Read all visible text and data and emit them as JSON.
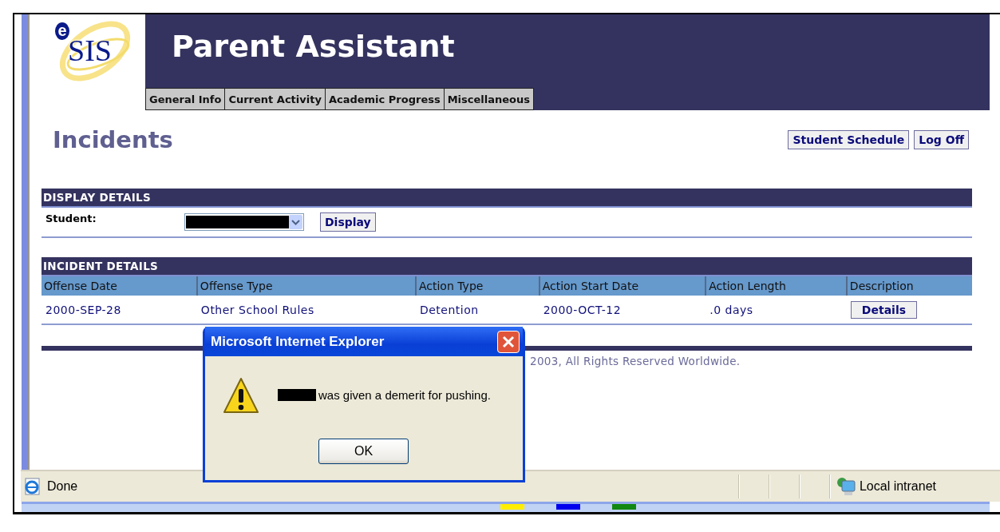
{
  "app": {
    "logo": {
      "mark": "e",
      "text": "SIS"
    },
    "title": "Parent Assistant",
    "tabs": [
      {
        "label": "General Info",
        "selected": false
      },
      {
        "label": "Current Activity",
        "selected": false
      },
      {
        "label": "Academic Progress",
        "selected": false
      },
      {
        "label": "Miscellaneous",
        "selected": false
      }
    ]
  },
  "page_title": "Incidents",
  "nav_buttons": [
    "Student Schedule",
    "Log Off"
  ],
  "display_details": {
    "heading": "DISPLAY DETAILS",
    "student_label": "Student:",
    "button": "Display"
  },
  "incident_details": {
    "heading": "INCIDENT DETAILS",
    "columns": [
      "Offense Date",
      "Offense Type",
      "Action Type",
      "Action Start Date",
      "Action Length",
      "Description"
    ],
    "rows": [
      {
        "offense_date": "2000-SEP-28",
        "offense_type": "Other School Rules",
        "action_type": "Detention",
        "action_start_date": "2000-OCT-12",
        "action_length": ".0 days",
        "description_button": "Details"
      }
    ]
  },
  "footer": "2003, All Rights Reserved Worldwide.",
  "dialog": {
    "title": "Microsoft Internet Explorer",
    "message": "was given a demerit for pushing.",
    "button": "OK"
  },
  "status_bar": {
    "status": "Done",
    "zone": "Local intranet"
  }
}
